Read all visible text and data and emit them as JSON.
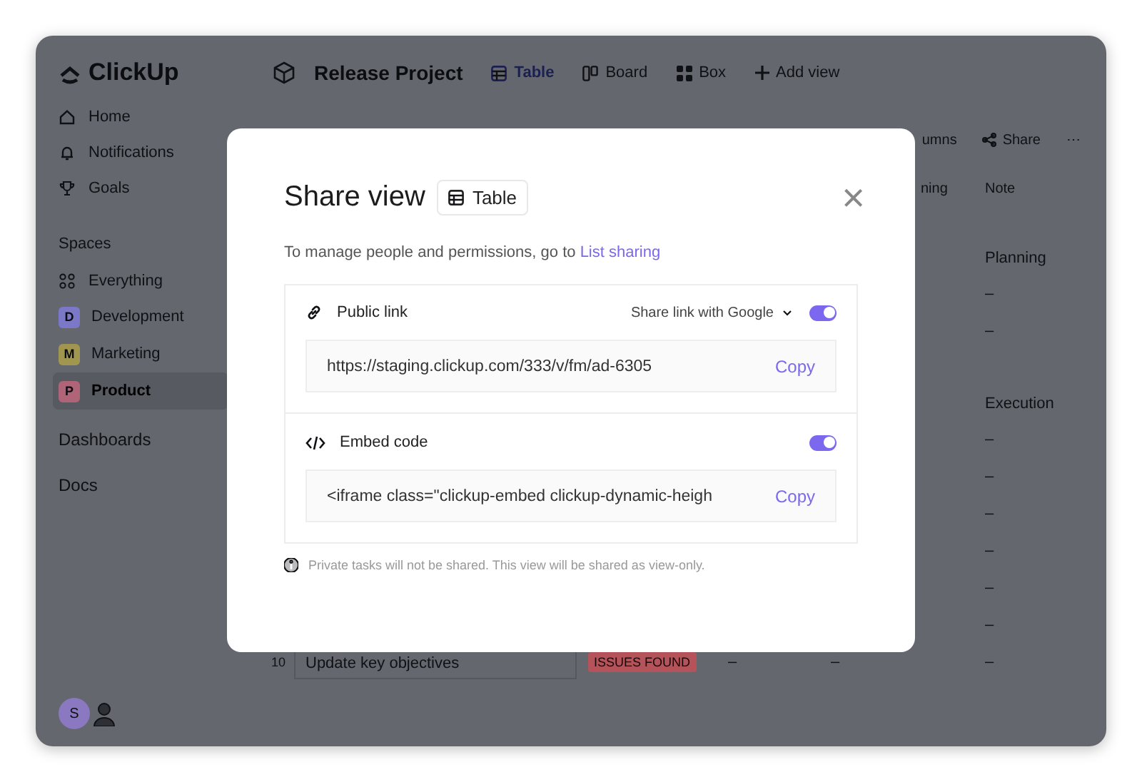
{
  "sidebar": {
    "logo": "ClickUp",
    "nav": [
      {
        "label": "Home"
      },
      {
        "label": "Notifications"
      },
      {
        "label": "Goals"
      }
    ],
    "spaces_heading": "Spaces",
    "everything": "Everything",
    "spaces": [
      {
        "initial": "D",
        "label": "Development",
        "color": "#7b78c8",
        "selected": false
      },
      {
        "initial": "M",
        "label": "Marketing",
        "color": "#a09650",
        "selected": false
      },
      {
        "initial": "P",
        "label": "Product",
        "color": "#b06478",
        "selected": true
      }
    ],
    "sections": [
      "Dashboards",
      "Docs"
    ],
    "user": {
      "initial": "S"
    }
  },
  "header": {
    "project": "Release Project",
    "views": [
      {
        "label": "Table",
        "selected": true
      },
      {
        "label": "Board",
        "selected": false
      },
      {
        "label": "Box",
        "selected": false
      },
      {
        "label": "Add view",
        "selected": false
      }
    ]
  },
  "toolbar": {
    "columns": "umns",
    "share": "Share",
    "more": "⋯"
  },
  "table": {
    "columns": [
      "ning",
      "Note"
    ],
    "groups": [
      {
        "label": "Planning",
        "rows": [
          {
            "cells": [
              "–"
            ]
          },
          {
            "cells": [
              "–"
            ]
          }
        ]
      },
      {
        "label": "Execution",
        "rows": [
          {
            "cells": [
              "–"
            ]
          },
          {
            "cells": [
              "–"
            ]
          },
          {
            "cells": [
              "–"
            ]
          },
          {
            "cells": [
              "–"
            ]
          },
          {
            "cells": [
              "–"
            ]
          },
          {
            "cells": [
              "–"
            ]
          },
          {
            "number": "10",
            "name": "Update key objectives",
            "status": "ISSUES FOUND",
            "cells": [
              "–",
              "–",
              "–"
            ]
          }
        ]
      }
    ]
  },
  "dialog": {
    "title": "Share view",
    "view_chip": "Table",
    "close": "×",
    "intro": "To manage people and permissions, go to",
    "intro_link": "List sharing",
    "sections": [
      {
        "kind": "link",
        "label": "Public link",
        "option": "Share link with Google",
        "on": true,
        "value": "https://staging.clickup.com/333/v/fm/ad-6305",
        "action": "Copy"
      },
      {
        "kind": "embed",
        "label": "Embed code",
        "on": true,
        "value": "<iframe class=\"clickup-embed clickup-dynamic-heigh",
        "action": "Copy"
      }
    ],
    "footnote": "Private tasks will not be shared. This view will be shared as view-only."
  }
}
